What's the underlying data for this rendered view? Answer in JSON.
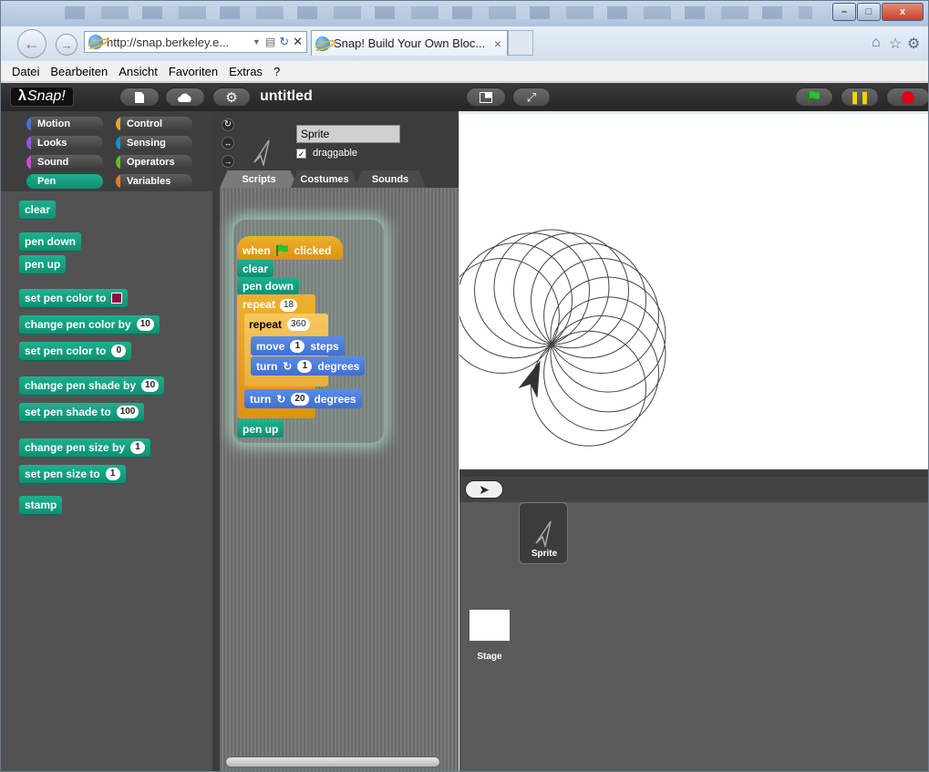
{
  "browser": {
    "url": "http://snap.berkeley.e...",
    "tab_title": "Snap! Build Your Own Bloc...",
    "tab_close": "×",
    "window_buttons": [
      "–",
      "□",
      "x"
    ],
    "back": "←",
    "forward": "→"
  },
  "menu": [
    "Datei",
    "Bearbeiten",
    "Ansicht",
    "Favoriten",
    "Extras",
    "?"
  ],
  "snap": {
    "logo": "Snap!",
    "project_title": "untitled"
  },
  "categories": [
    {
      "label": "Motion",
      "color": "#4a6cd4"
    },
    {
      "label": "Control",
      "color": "#e6a822"
    },
    {
      "label": "Looks",
      "color": "#8f56e3"
    },
    {
      "label": "Sensing",
      "color": "#0494dc"
    },
    {
      "label": "Sound",
      "color": "#cf4ad9"
    },
    {
      "label": "Operators",
      "color": "#62c213"
    },
    {
      "label": "Pen",
      "color": "#00a178"
    },
    {
      "label": "Variables",
      "color": "#f3761d"
    }
  ],
  "palette_blocks": {
    "clear": "clear",
    "pen_down": "pen down",
    "pen_up": "pen up",
    "set_pen_color_to": "set pen color to",
    "change_pen_color_by": "change pen color by",
    "change_pen_color_val": "10",
    "set_pen_color_to_num": "set pen color to",
    "set_pen_color_val": "0",
    "change_pen_shade_by": "change pen shade by",
    "change_pen_shade_val": "10",
    "set_pen_shade_to": "set pen shade to",
    "set_pen_shade_val": "100",
    "change_pen_size_by": "change pen size by",
    "change_pen_size_val": "1",
    "set_pen_size_to": "set pen size to",
    "set_pen_size_val": "1",
    "stamp": "stamp"
  },
  "sprite": {
    "name": "Sprite",
    "draggable_label": "draggable",
    "draggable_checked": true,
    "tabs": [
      "Scripts",
      "Costumes",
      "Sounds"
    ]
  },
  "script": {
    "when": "when",
    "clicked": "clicked",
    "clear": "clear",
    "pen_down": "pen down",
    "repeat_outer": "repeat",
    "repeat_outer_val": "18",
    "repeat_inner": "repeat",
    "repeat_inner_val": "360",
    "move": "move",
    "move_val": "1",
    "steps": "steps",
    "turn": "turn",
    "turn_inner_val": "1",
    "degrees": "degrees",
    "turn_outer_val": "20",
    "pen_up": "pen up"
  },
  "corral": {
    "sprite_label": "Sprite",
    "stage_label": "Stage"
  },
  "colors": {
    "pen": "#0f9b7a",
    "control": "#e6a822",
    "motion": "#4a6cd4",
    "pen_swatch": "#8d0f3e"
  }
}
